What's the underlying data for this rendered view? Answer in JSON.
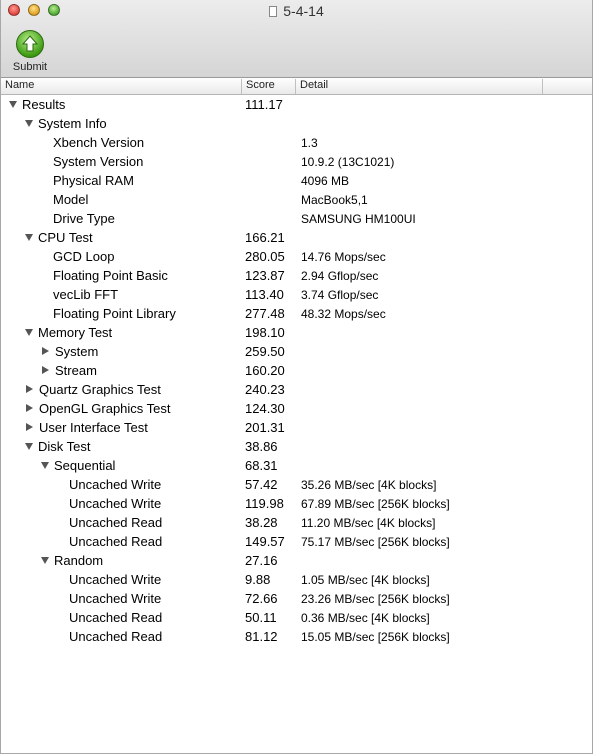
{
  "window": {
    "title": "5-4-14"
  },
  "toolbar": {
    "submit_label": "Submit"
  },
  "columns": {
    "name": "Name",
    "score": "Score",
    "detail": "Detail"
  },
  "rows": [
    {
      "name": "Results",
      "score": "111.17",
      "detail": "",
      "level": 0,
      "disclosure": "open"
    },
    {
      "name": "System Info",
      "score": "",
      "detail": "",
      "level": 1,
      "disclosure": "open"
    },
    {
      "name": "Xbench Version",
      "score": "",
      "detail": "1.3",
      "level": 2,
      "disclosure": "none"
    },
    {
      "name": "System Version",
      "score": "",
      "detail": "10.9.2 (13C1021)",
      "level": 2,
      "disclosure": "none"
    },
    {
      "name": "Physical RAM",
      "score": "",
      "detail": "4096 MB",
      "level": 2,
      "disclosure": "none"
    },
    {
      "name": "Model",
      "score": "",
      "detail": "MacBook5,1",
      "level": 2,
      "disclosure": "none"
    },
    {
      "name": "Drive Type",
      "score": "",
      "detail": "SAMSUNG HM100UI",
      "level": 2,
      "disclosure": "none"
    },
    {
      "name": "CPU Test",
      "score": "166.21",
      "detail": "",
      "level": 1,
      "disclosure": "open"
    },
    {
      "name": "GCD Loop",
      "score": "280.05",
      "detail": "14.76 Mops/sec",
      "level": 2,
      "disclosure": "none"
    },
    {
      "name": "Floating Point Basic",
      "score": "123.87",
      "detail": "2.94 Gflop/sec",
      "level": 2,
      "disclosure": "none"
    },
    {
      "name": "vecLib FFT",
      "score": "113.40",
      "detail": "3.74 Gflop/sec",
      "level": 2,
      "disclosure": "none"
    },
    {
      "name": "Floating Point Library",
      "score": "277.48",
      "detail": "48.32 Mops/sec",
      "level": 2,
      "disclosure": "none"
    },
    {
      "name": "Memory Test",
      "score": "198.10",
      "detail": "",
      "level": 1,
      "disclosure": "open"
    },
    {
      "name": "System",
      "score": "259.50",
      "detail": "",
      "level": 2,
      "disclosure": "closed"
    },
    {
      "name": "Stream",
      "score": "160.20",
      "detail": "",
      "level": 2,
      "disclosure": "closed"
    },
    {
      "name": "Quartz Graphics Test",
      "score": "240.23",
      "detail": "",
      "level": 1,
      "disclosure": "closed"
    },
    {
      "name": "OpenGL Graphics Test",
      "score": "124.30",
      "detail": "",
      "level": 1,
      "disclosure": "closed"
    },
    {
      "name": "User Interface Test",
      "score": "201.31",
      "detail": "",
      "level": 1,
      "disclosure": "closed"
    },
    {
      "name": "Disk Test",
      "score": "38.86",
      "detail": "",
      "level": 1,
      "disclosure": "open"
    },
    {
      "name": "Sequential",
      "score": "68.31",
      "detail": "",
      "level": 2,
      "disclosure": "open"
    },
    {
      "name": "Uncached Write",
      "score": "57.42",
      "detail": "35.26 MB/sec [4K blocks]",
      "level": 3,
      "disclosure": "none"
    },
    {
      "name": "Uncached Write",
      "score": "119.98",
      "detail": "67.89 MB/sec [256K blocks]",
      "level": 3,
      "disclosure": "none"
    },
    {
      "name": "Uncached Read",
      "score": "38.28",
      "detail": "11.20 MB/sec [4K blocks]",
      "level": 3,
      "disclosure": "none"
    },
    {
      "name": "Uncached Read",
      "score": "149.57",
      "detail": "75.17 MB/sec [256K blocks]",
      "level": 3,
      "disclosure": "none"
    },
    {
      "name": "Random",
      "score": "27.16",
      "detail": "",
      "level": 2,
      "disclosure": "open"
    },
    {
      "name": "Uncached Write",
      "score": "9.88",
      "detail": "1.05 MB/sec [4K blocks]",
      "level": 3,
      "disclosure": "none"
    },
    {
      "name": "Uncached Write",
      "score": "72.66",
      "detail": "23.26 MB/sec [256K blocks]",
      "level": 3,
      "disclosure": "none"
    },
    {
      "name": "Uncached Read",
      "score": "50.11",
      "detail": "0.36 MB/sec [4K blocks]",
      "level": 3,
      "disclosure": "none"
    },
    {
      "name": "Uncached Read",
      "score": "81.12",
      "detail": "15.05 MB/sec [256K blocks]",
      "level": 3,
      "disclosure": "none"
    }
  ]
}
